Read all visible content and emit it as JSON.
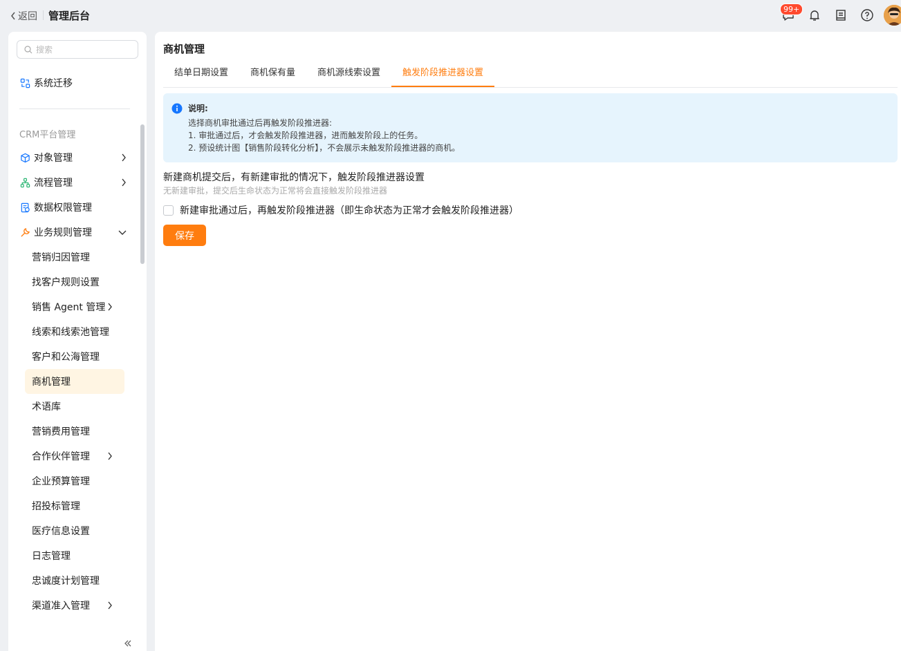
{
  "header": {
    "back_label": "返回",
    "app_title": "管理后台",
    "message_badge": "99+",
    "icons": [
      "chat-icon",
      "bell-icon",
      "inbox-icon",
      "help-icon"
    ]
  },
  "sidebar": {
    "search_placeholder": "搜索",
    "top_item": "系统迁移",
    "group_label": "CRM平台管理",
    "items": [
      {
        "label": "对象管理",
        "icon": "object-icon",
        "expandable": true
      },
      {
        "label": "流程管理",
        "icon": "flow-icon",
        "expandable": true
      },
      {
        "label": "数据权限管理",
        "icon": "permission-icon",
        "expandable": false
      },
      {
        "label": "业务规则管理",
        "icon": "rule-icon",
        "expanded": true
      }
    ],
    "sub_items": [
      {
        "label": "营销归因管理"
      },
      {
        "label": "找客户规则设置"
      },
      {
        "label": "销售 Agent 管理",
        "expandable": true
      },
      {
        "label": "线索和线索池管理"
      },
      {
        "label": "客户和公海管理"
      },
      {
        "label": "商机管理",
        "active": true
      },
      {
        "label": "术语库"
      },
      {
        "label": "营销费用管理"
      },
      {
        "label": "合作伙伴管理",
        "expandable": true
      },
      {
        "label": "企业预算管理"
      },
      {
        "label": "招投标管理"
      },
      {
        "label": "医疗信息设置"
      },
      {
        "label": "日志管理"
      },
      {
        "label": "忠诚度计划管理"
      },
      {
        "label": "渠道准入管理",
        "expandable": true
      }
    ]
  },
  "main": {
    "title": "商机管理",
    "tabs": [
      {
        "label": "结单日期设置"
      },
      {
        "label": "商机保有量"
      },
      {
        "label": "商机源线索设置"
      },
      {
        "label": "触发阶段推进器设置",
        "active": true
      }
    ],
    "notice": {
      "title": "说明:",
      "lines": [
        "选择商机审批通过后再触发阶段推进器:",
        "1. 审批通过后，才会触发阶段推进器，进而触发阶段上的任务。",
        "2. 预设统计图【销售阶段转化分析】，不会展示未触发阶段推进器的商机。"
      ]
    },
    "section_title": "新建商机提交后，有新建审批的情况下，触发阶段推进器设置",
    "section_subtitle": "无新建审批，提交后生命状态为正常将会直接触发阶段推进器",
    "checkbox_label": "新建审批通过后，再触发阶段推进器（即生命状态为正常才会触发阶段推进器）",
    "checkbox_checked": false,
    "save_label": "保存"
  },
  "colors": {
    "accent": "#ff7d0f",
    "badge": "#ff4a2e",
    "notice_bg": "#e6f4fd",
    "active_menu_bg": "#fff5e3",
    "info_blue": "#1677ff"
  }
}
